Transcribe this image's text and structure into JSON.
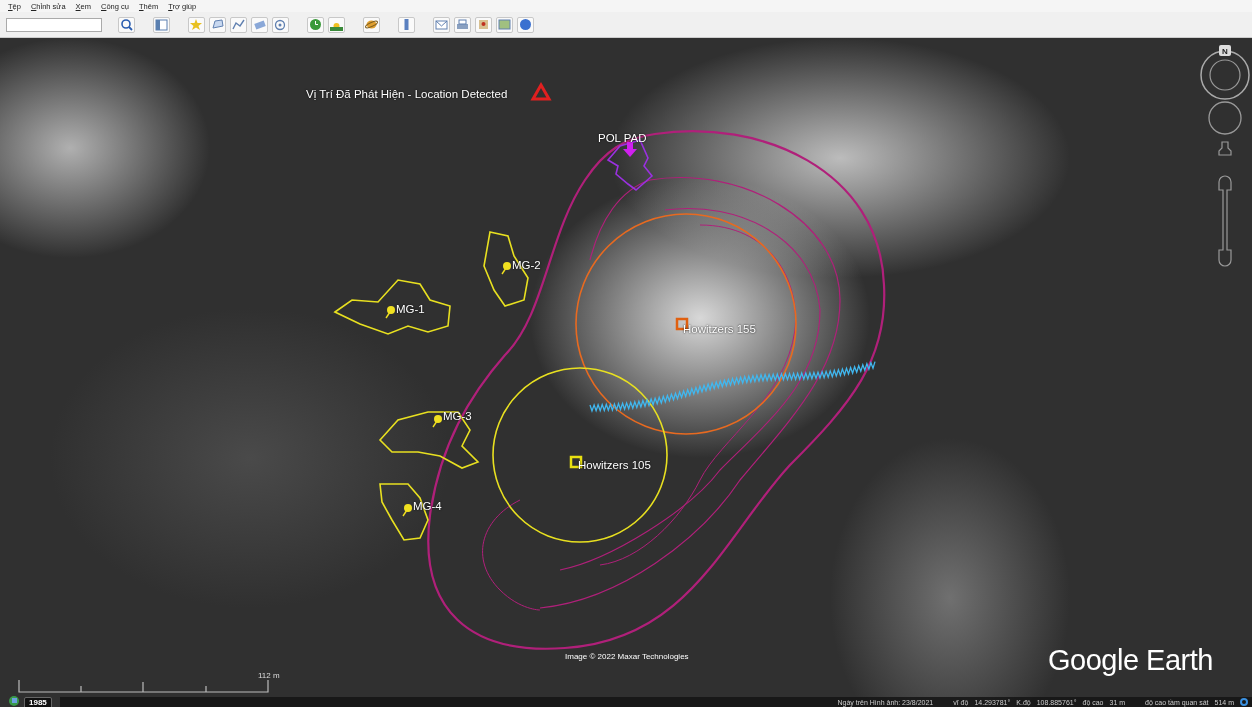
{
  "menu": [
    {
      "label": "Tệp"
    },
    {
      "label": "Chỉnh sửa"
    },
    {
      "label": "Xem"
    },
    {
      "label": "Công cụ"
    },
    {
      "label": "Thêm"
    },
    {
      "label": "Trợ giúp"
    }
  ],
  "compass": {
    "label": "N"
  },
  "placemarks": [
    {
      "label": "Vị Trí Đã Phát Hiện - Location Detected",
      "kind": "triangle",
      "color": "#e02020"
    },
    {
      "label": "POL PAD",
      "kind": "arrow",
      "color": "#d020f0"
    },
    {
      "label": "MG-2",
      "kind": "pin",
      "color": "#f0e020"
    },
    {
      "label": "MG-1",
      "kind": "pin",
      "color": "#f0e020"
    },
    {
      "label": "Howitzers 155",
      "kind": "square",
      "color": "#e06010"
    },
    {
      "label": "MG-3",
      "kind": "pin",
      "color": "#f0e020"
    },
    {
      "label": "Howitzers 105",
      "kind": "square",
      "color": "#e8e010"
    },
    {
      "label": "MG-4",
      "kind": "pin",
      "color": "#f0e020"
    }
  ],
  "attribution": "Image © 2022 Maxar Technologies",
  "logo": "Google Earth",
  "scale": {
    "label": "112 m"
  },
  "history": {
    "year": "1985"
  },
  "status_bar": {
    "imagery_date": "Ngày trên Hình ảnh: 23/8/2021",
    "latitude_label": "vĩ độ",
    "latitude": "14.293781°",
    "longitude_label": "K.độ",
    "longitude": "108.885761°",
    "elevation_label": "độ cao",
    "elevation": "31 m",
    "eye_alt_label": "độ cao tầm quan sát",
    "eye_alt": "514 m"
  }
}
